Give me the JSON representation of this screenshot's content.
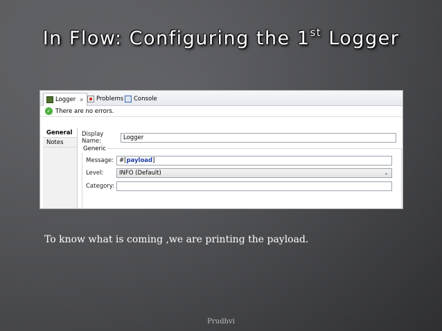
{
  "slide": {
    "title_main": "In Flow: Configuring the 1",
    "title_sup": "st",
    "title_end": " Logger",
    "caption": "To know what is coming ,we are printing the payload.",
    "footer": "Prudhvi",
    "colors": {
      "background": "#55565b",
      "title": "#ffffff",
      "caption": "#ffffff",
      "footer": "#bfc0c4"
    }
  },
  "editor": {
    "tabs": [
      {
        "label": "Logger",
        "icon": "logger-icon",
        "active": true,
        "closable": true
      },
      {
        "label": "Problems",
        "icon": "problems-icon",
        "active": false
      },
      {
        "label": "Console",
        "icon": "console-icon",
        "active": false
      }
    ],
    "status": {
      "icon": "check-circle-icon",
      "text": "There are no errors."
    },
    "side_tabs": [
      "General",
      "Notes"
    ],
    "display_name": {
      "label": "Display Name:",
      "value": "Logger"
    },
    "group_label": "Generic",
    "message": {
      "label": "Message:",
      "hash": "#",
      "open": "[",
      "keyword": "payload",
      "close": "]"
    },
    "level": {
      "label": "Level:",
      "value": "INFO (Default)"
    },
    "category": {
      "label": "Category:",
      "value": ""
    }
  }
}
